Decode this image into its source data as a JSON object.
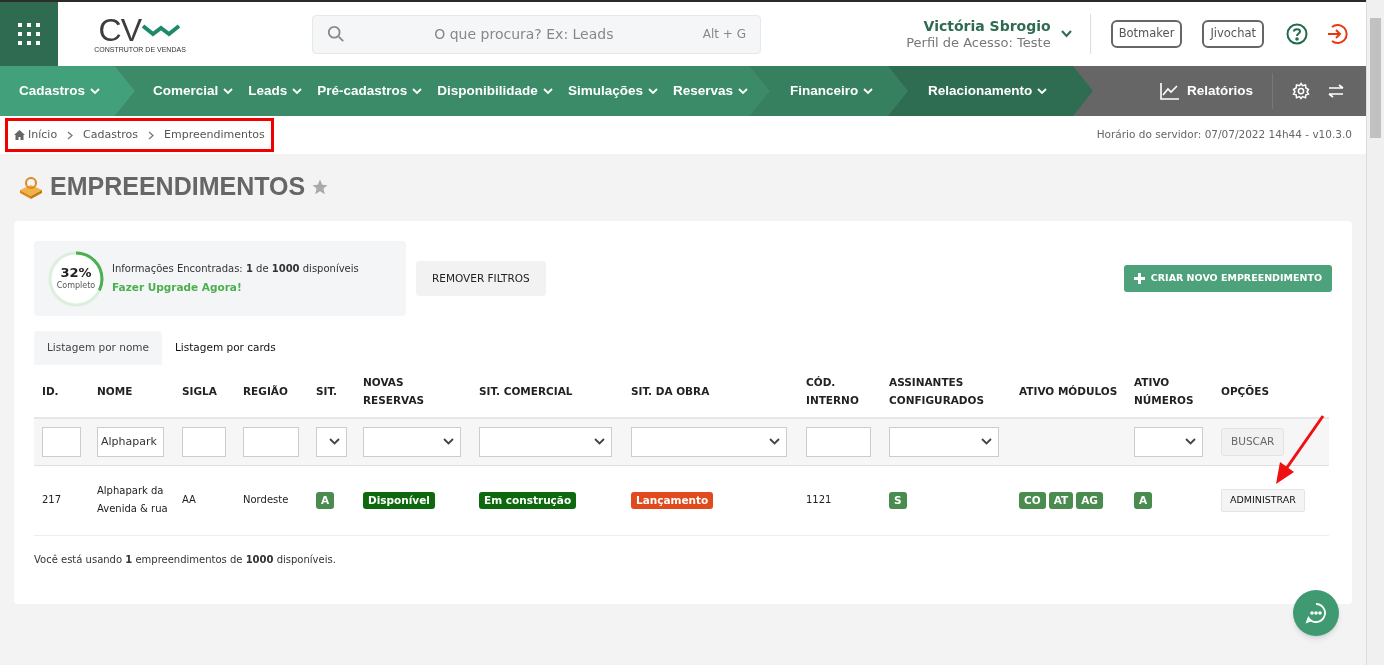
{
  "header": {
    "logo": {
      "text": "CV",
      "tagline": "CONSTRUTOR DE VENDAS"
    },
    "search": {
      "placeholder": "O que procura? Ex: Leads",
      "shortcut": "Alt + G"
    },
    "user": {
      "name": "Victória Sbrogio",
      "profile": "Perfil de Acesso: Teste"
    },
    "buttons": [
      "Botmaker",
      "Jivochat"
    ]
  },
  "nav": {
    "segments": [
      {
        "items": [
          "Cadastros"
        ]
      },
      {
        "items": [
          "Comercial",
          "Leads",
          "Pré-cadastros",
          "Disponibilidade",
          "Simulações",
          "Reservas"
        ]
      },
      {
        "items": [
          "Financeiro"
        ]
      },
      {
        "items": [
          "Relacionamento"
        ]
      }
    ],
    "reports": "Relatórios"
  },
  "breadcrumb": {
    "items": [
      "Início",
      "Cadastros",
      "Empreendimentos"
    ],
    "highlighted": true
  },
  "server_time": "Horário do servidor: 07/07/2022 14h44 - v10.3.0",
  "page_title": "EMPREENDIMENTOS",
  "favorite": false,
  "usage": {
    "percent": "32%",
    "caption": "Completo",
    "level": 0.32,
    "info": "Informações Encontradas: **1** de **1000** disponíveis",
    "upgrade": "Fazer Upgrade Agora!"
  },
  "remove_filters": "REMOVER FILTROS",
  "create_button": "CRIAR NOVO EMPREENDIMENTO",
  "tabs": [
    {
      "label": "Listagem por nome",
      "selected": true
    },
    {
      "label": "Listagem por cards",
      "selected": false
    }
  ],
  "table": {
    "columns": [
      "ID.",
      "NOME",
      "SIGLA",
      "REGIÃO",
      "SIT.",
      "NOVAS RESERVAS",
      "SIT. COMERCIAL",
      "SIT. DA OBRA",
      "CÓD. INTERNO",
      "ASSINANTES CONFIGURADOS",
      "ATIVO MÓDULOS",
      "ATIVO NÚMEROS",
      "OPÇÕES"
    ],
    "filters": [
      {
        "kind": "text"
      },
      {
        "kind": "text",
        "value": "Alphapark"
      },
      {
        "kind": "text"
      },
      {
        "kind": "text"
      },
      {
        "kind": "select"
      },
      {
        "kind": "select"
      },
      {
        "kind": "select"
      },
      {
        "kind": "select"
      },
      {
        "kind": "text"
      },
      {
        "kind": "select"
      },
      {
        "kind": "none"
      },
      {
        "kind": "select"
      },
      {
        "kind": "button",
        "label": "BUSCAR"
      }
    ],
    "rows": [
      {
        "cells": [
          {
            "kind": "text",
            "text": "217"
          },
          {
            "kind": "text",
            "text": "Alphapark da Avenida & rua"
          },
          {
            "kind": "text",
            "text": "AA"
          },
          {
            "kind": "text",
            "text": "Nordeste"
          },
          {
            "kind": "badges",
            "badges": [
              {
                "text": "A",
                "color": "#4a8b4f"
              }
            ]
          },
          {
            "kind": "badges",
            "badges": [
              {
                "text": "Disponível",
                "color": "#0e690e"
              }
            ]
          },
          {
            "kind": "badges",
            "badges": [
              {
                "text": "Em construção",
                "color": "#0e690e"
              }
            ]
          },
          {
            "kind": "badges",
            "badges": [
              {
                "text": "Lançamento",
                "color": "#e04a1c"
              }
            ]
          },
          {
            "kind": "text",
            "text": "1121"
          },
          {
            "kind": "badges",
            "badges": [
              {
                "text": "S",
                "color": "#4a8b4f"
              }
            ]
          },
          {
            "kind": "badges",
            "badges": [
              {
                "text": "CO",
                "color": "#4a8b4f"
              },
              {
                "text": "AT",
                "color": "#4a8b4f"
              },
              {
                "text": "AG",
                "color": "#4a8b4f"
              }
            ]
          },
          {
            "kind": "badges",
            "badges": [
              {
                "text": "A",
                "color": "#4a8b4f"
              }
            ]
          },
          {
            "kind": "button",
            "text": "ADMINISTRAR"
          }
        ]
      }
    ]
  },
  "usage_note": "Você está usando **1** empreendimentos de **1000** disponíveis.",
  "annotation_arrow": true
}
